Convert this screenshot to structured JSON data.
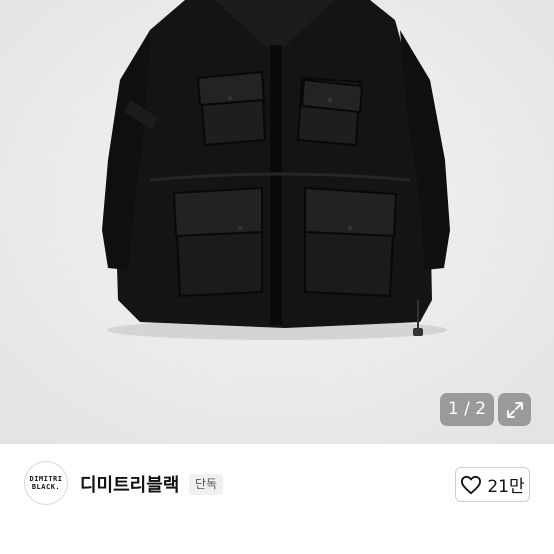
{
  "gallery": {
    "counter": "1 / 2",
    "expand_icon": "expand-icon"
  },
  "store": {
    "logo_line1": "DIMITRI",
    "logo_line2": "BLACK.",
    "name": "디미트리블랙",
    "badge": "단독",
    "like_icon": "heart-icon",
    "like_count": "21만"
  },
  "colors": {
    "jacket": "#121212",
    "overlay": "#808080"
  }
}
